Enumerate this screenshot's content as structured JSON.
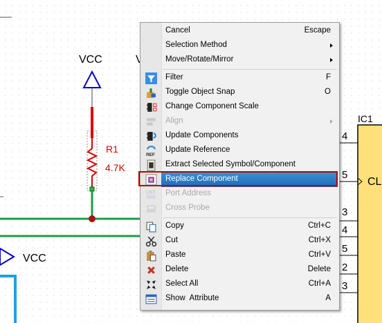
{
  "schematic": {
    "vcc_top_label": "VCC",
    "vcc_bottom_label": "VCC",
    "partial_label": "V",
    "resistor_ref": "R1",
    "resistor_value": "4.7K",
    "ic_ref": "IC1",
    "pin_numbers": [
      "4",
      "5",
      "3",
      "4",
      "5",
      "2",
      "3"
    ],
    "pin_name": "CL",
    "colors": {
      "wire": "#1e9a4a",
      "vcc": "#0000cc",
      "red_wire": "#dd0000",
      "ic_fill": "#ffe07a",
      "blue_wire": "#1ea0e6"
    }
  },
  "context_menu": {
    "items": [
      {
        "label": "Cancel",
        "shortcut": "Escape",
        "icon": "",
        "submenu": false,
        "enabled": true
      },
      {
        "label": "Selection Method",
        "shortcut": "",
        "icon": "",
        "submenu": true,
        "enabled": true
      },
      {
        "label": "Move/Rotate/Mirror",
        "shortcut": "",
        "icon": "",
        "submenu": true,
        "enabled": true
      },
      {
        "label": "Filter",
        "shortcut": "F",
        "icon": "filter-icon",
        "submenu": false,
        "enabled": true
      },
      {
        "label": "Toggle Object Snap",
        "shortcut": "O",
        "icon": "object-snap-icon",
        "submenu": false,
        "enabled": true
      },
      {
        "label": "Change Component Scale",
        "shortcut": "",
        "icon": "component-scale-icon",
        "submenu": false,
        "enabled": true
      },
      {
        "label": "Align",
        "shortcut": "",
        "icon": "align-icon",
        "submenu": true,
        "enabled": false
      },
      {
        "label": "Update Components",
        "shortcut": "",
        "icon": "update-components-icon",
        "submenu": false,
        "enabled": true
      },
      {
        "label": "Update Reference",
        "shortcut": "",
        "icon": "update-reference-icon",
        "submenu": false,
        "enabled": true
      },
      {
        "label": "Extract Selected Symbol/Component",
        "shortcut": "",
        "icon": "extract-symbol-icon",
        "submenu": false,
        "enabled": true
      },
      {
        "label": "Replace Component",
        "shortcut": "",
        "icon": "replace-component-icon",
        "submenu": false,
        "enabled": true,
        "selected": true
      },
      {
        "label": "Port Address",
        "shortcut": "",
        "icon": "port-address-icon",
        "submenu": false,
        "enabled": false
      },
      {
        "label": "Cross Probe",
        "shortcut": "",
        "icon": "cross-probe-icon",
        "submenu": false,
        "enabled": false
      },
      {
        "label": "Copy",
        "shortcut": "Ctrl+C",
        "icon": "copy-icon",
        "submenu": false,
        "enabled": true
      },
      {
        "label": "Cut",
        "shortcut": "Ctrl+X",
        "icon": "cut-icon",
        "submenu": false,
        "enabled": true
      },
      {
        "label": "Paste",
        "shortcut": "Ctrl+V",
        "icon": "paste-icon",
        "submenu": false,
        "enabled": true
      },
      {
        "label": "Delete",
        "shortcut": "Delete",
        "icon": "delete-icon",
        "submenu": false,
        "enabled": true
      },
      {
        "label": "Select All",
        "shortcut": "Ctrl+A",
        "icon": "select-all-icon",
        "submenu": false,
        "enabled": true
      },
      {
        "label": "Show  Attribute",
        "shortcut": "A",
        "icon": "show-attribute-icon",
        "submenu": false,
        "enabled": true
      }
    ]
  }
}
